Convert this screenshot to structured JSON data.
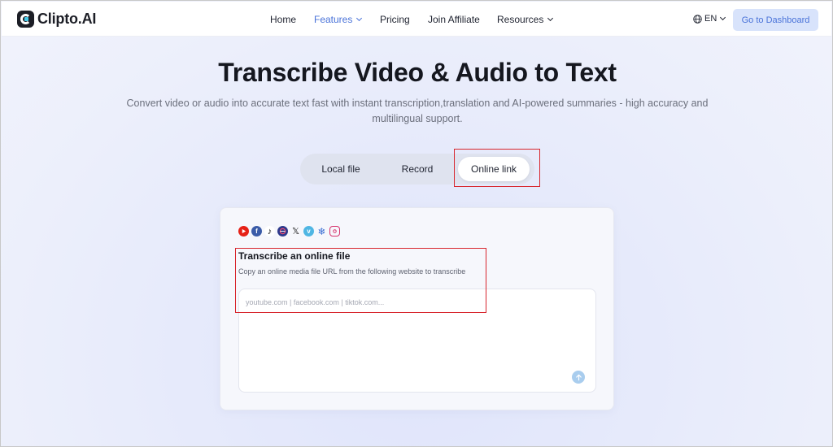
{
  "brand": {
    "name": "Clipto.AI"
  },
  "nav": {
    "items": [
      {
        "label": "Home",
        "dropdown": false,
        "active": false
      },
      {
        "label": "Features",
        "dropdown": true,
        "active": true
      },
      {
        "label": "Pricing",
        "dropdown": false,
        "active": false
      },
      {
        "label": "Join Affiliate",
        "dropdown": false,
        "active": false
      },
      {
        "label": "Resources",
        "dropdown": true,
        "active": false
      }
    ],
    "language": "EN",
    "dashboard_button": "Go to Dashboard"
  },
  "hero": {
    "title": "Transcribe Video & Audio to Text",
    "subtitle": "Convert video or audio into accurate text fast with instant transcription,translation and AI-powered summaries - high accuracy and multilingual support."
  },
  "tabs": [
    {
      "label": "Local file",
      "selected": false
    },
    {
      "label": "Record",
      "selected": false
    },
    {
      "label": "Online link",
      "selected": true
    }
  ],
  "card": {
    "platform_icons": [
      "youtube-icon",
      "facebook-icon",
      "tiktok-icon",
      "bilibili-icon",
      "x-icon",
      "vimeo-icon",
      "snowflake-icon",
      "instagram-icon"
    ],
    "title": "Transcribe an online file",
    "description": "Copy an online media file URL from the following website to transcribe",
    "input": {
      "value": "",
      "placeholder": "youtube.com | facebook.com | tiktok.com..."
    }
  },
  "colors": {
    "accent": "#4a73d9",
    "dashboard_bg": "#d8e3fb",
    "highlight_box": "#d8262d",
    "send_button": "#a9cdee"
  }
}
